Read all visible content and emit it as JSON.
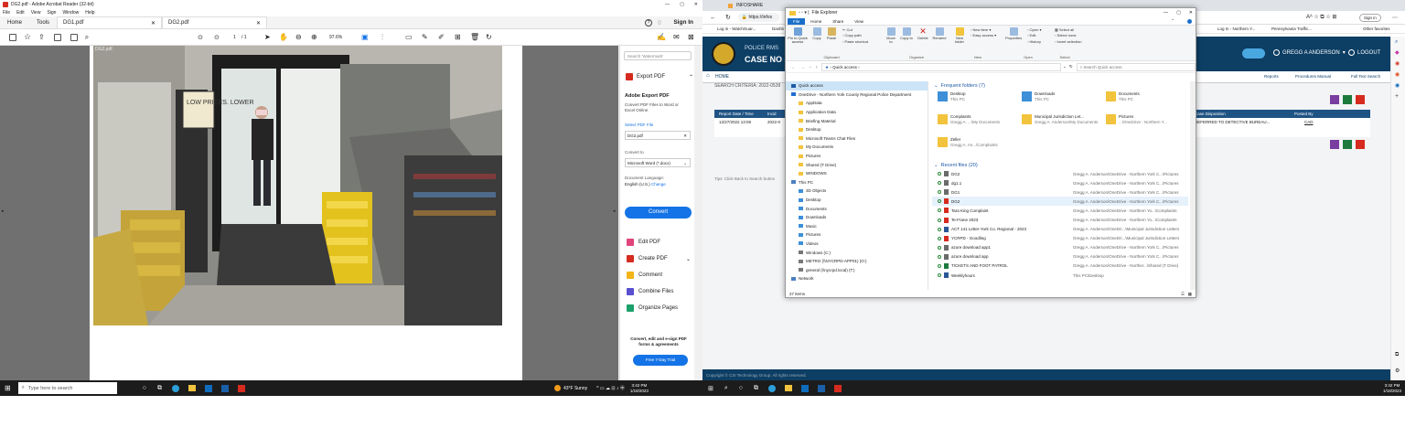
{
  "acrobat": {
    "window_title": "DG2.pdf - Adobe Acrobat Reader (32-bit)",
    "menu": [
      "File",
      "Edit",
      "View",
      "Sign",
      "Window",
      "Help"
    ],
    "tabs": {
      "home": "Home",
      "tools": "Tools",
      "doc1": "DG1.pdf",
      "doc2": "DG2.pdf"
    },
    "sign_in": "Sign In",
    "page_current": "1",
    "page_total": "/ 1",
    "zoom": "97.6%",
    "photo_caption": "DG2.pdf",
    "store_sign": "LOW PRICES. LOWER"
  },
  "export_panel": {
    "search_placeholder": "Search 'Watermark'",
    "title": "Export PDF",
    "heading": "Adobe Export PDF",
    "desc": "Convert PDF Files to Word or Excel Online",
    "select_label": "Select PDF File",
    "file": "DG2.pdf",
    "convert_to": "Convert to",
    "format": "Microsoft Word (*.docx)",
    "lang_label": "Document Language:",
    "lang": "English (U.S.)",
    "change": "Change",
    "convert_btn": "Convert",
    "tools": [
      "Edit PDF",
      "Create PDF",
      "Comment",
      "Combine Files",
      "Organize Pages"
    ],
    "promo": "Convert, edit and e-sign PDF forms & agreements",
    "trial_btn": "Free 7-Day Trial"
  },
  "taskbar_left": {
    "search": "Type here to search",
    "weather": "43°F Sunny",
    "time": "3:42 PM",
    "date": "1/18/2023"
  },
  "browser": {
    "tab": "INFOSHARE",
    "url": "https://infos",
    "bookmarks": [
      "Log in - WatchGuar...",
      "Dashb",
      "Log In - Northern Y...",
      "Pennsylvania Traffic...",
      "Other favorites"
    ],
    "sign_in": "Sign in"
  },
  "rms": {
    "line1": "POLICE RMS",
    "line2": "CASE NO SE",
    "user": "GREGG A ANDERSON",
    "logout": "LOGOUT",
    "home": "HOME",
    "criteria_label": "SEARCH CRITERIA:",
    "criteria_value": "2022-0539",
    "links": [
      "Reports",
      "Procedures Manual",
      "Full Text Search"
    ],
    "columns": [
      "Report Date / Time",
      "Incid",
      "Case Disposition",
      "Posted By"
    ],
    "row": {
      "date": "12/27/2022 13:08",
      "id": "2022-0",
      "disposition": "REFERRED TO DETECTIVE BUREAU...",
      "posted": "CAD"
    },
    "tips": "Tips: Click Back to Search button",
    "footer": "Copyright © CSI Technology Group. All rights reserved."
  },
  "file_explorer": {
    "title": "File Explorer",
    "ribbon_tabs": [
      "File",
      "Home",
      "Share",
      "View"
    ],
    "ribbon": {
      "pin": "Pin to Quick access",
      "copy": "Copy",
      "paste": "Paste",
      "cut": "Cut",
      "copy_path": "Copy path",
      "paste_shortcut": "Paste shortcut",
      "move_to": "Move to",
      "copy_to": "Copy to",
      "delete": "Delete",
      "rename": "Rename",
      "new_folder": "New folder",
      "new_item": "New item",
      "easy_access": "Easy access",
      "properties": "Properties",
      "open": "Open",
      "edit": "Edit",
      "history": "History",
      "select_all": "Select all",
      "select_none": "Select none",
      "invert": "Invert selection",
      "groups": [
        "Clipboard",
        "Organize",
        "New",
        "Open",
        "Select"
      ]
    },
    "address": "Quick access",
    "search_placeholder": "Search Quick access",
    "nav": [
      {
        "label": "Quick access",
        "kind": "star"
      },
      {
        "label": "OneDrive - Northern York County Regional Police Department",
        "kind": "cloud"
      },
      {
        "label": "AppData",
        "kind": "folder"
      },
      {
        "label": "Application Data",
        "kind": "folder"
      },
      {
        "label": "Briefing Material",
        "kind": "folder"
      },
      {
        "label": "Desktop",
        "kind": "folder"
      },
      {
        "label": "Microsoft Teams Chat Files",
        "kind": "folder"
      },
      {
        "label": "My Documents",
        "kind": "folder"
      },
      {
        "label": "Pictures",
        "kind": "folder"
      },
      {
        "label": "Shared (T Drive)",
        "kind": "folder"
      },
      {
        "label": "WINDOWS",
        "kind": "folder"
      },
      {
        "label": "This PC",
        "kind": "pc"
      },
      {
        "label": "3D Objects",
        "kind": "blue"
      },
      {
        "label": "Desktop",
        "kind": "blue"
      },
      {
        "label": "Documents",
        "kind": "blue"
      },
      {
        "label": "Downloads",
        "kind": "blue"
      },
      {
        "label": "Music",
        "kind": "blue"
      },
      {
        "label": "Pictures",
        "kind": "blue"
      },
      {
        "label": "Videos",
        "kind": "blue"
      },
      {
        "label": "Windows (C:)",
        "kind": "drive"
      },
      {
        "label": "METRO (\\\\NYCRPD-APP01) (O:)",
        "kind": "drive"
      },
      {
        "label": "general (\\\\nycrpd.local) (T:)",
        "kind": "drive"
      },
      {
        "label": "Network",
        "kind": "net"
      }
    ],
    "frequent_header": "Frequent folders (7)",
    "frequent": [
      {
        "name": "Desktop",
        "sub": "This PC"
      },
      {
        "name": "Downloads",
        "sub": "This PC"
      },
      {
        "name": "Documents",
        "sub": "This PC"
      },
      {
        "name": "Complaints",
        "sub": "Gregg A. ...\\My Documents"
      },
      {
        "name": "Municipal Jurisdiction Let...",
        "sub": "Gregg A. Anderson\\My Documents"
      },
      {
        "name": "Pictures",
        "sub": "...\\OneDrive - Northern Y..."
      },
      {
        "name": "Zeller",
        "sub": "Gregg A. An...\\Complaints"
      }
    ],
    "recent_header": "Recent files (20)",
    "recent": [
      {
        "name": "DG2",
        "path": "Gregg A. Anderson\\OneDrive - Northern York C...\\Pictures",
        "kind": "img"
      },
      {
        "name": "dg1.1",
        "path": "Gregg A. Anderson\\OneDrive - Northern York C...\\Pictures",
        "kind": "img"
      },
      {
        "name": "DG1",
        "path": "Gregg A. Anderson\\OneDrive - Northern York C...\\Pictures",
        "kind": "img"
      },
      {
        "name": "DG2",
        "path": "Gregg A. Anderson\\OneDrive - Northern York C...\\Pictures",
        "kind": "pdf"
      },
      {
        "name": "Tara King Complaint",
        "path": "Gregg A. Anderson\\OneDrive - Northern Yo...\\Complaints",
        "kind": "pdf"
      },
      {
        "name": "Te-Frane 2023",
        "path": "Gregg A. Anderson\\OneDrive - Northern Yo...\\Complaints",
        "kind": "pdf"
      },
      {
        "name": "ACT 141 Letter-York Co. Regional - 2023",
        "path": "Gregg A. Anderson\\OneDri...\\Municipal Jurisdiction Letters",
        "kind": "doc"
      },
      {
        "name": "YCRPD - Goodling",
        "path": "Gregg A. Anderson\\OneDri...\\Municipal Jurisdiction Letters",
        "kind": "pdf"
      },
      {
        "name": "azure download app1",
        "path": "Gregg A. Anderson\\OneDrive - Northern York C...\\Pictures",
        "kind": "img"
      },
      {
        "name": "azure download app",
        "path": "Gregg A. Anderson\\OneDrive - Northern York C...\\Pictures",
        "kind": "img"
      },
      {
        "name": "TICKETS AND FOOT PATROL",
        "path": "Gregg A. Anderson\\OneDrive - Norther...\\Shared (T Drive)",
        "kind": "xls"
      },
      {
        "name": "Weeklyhours",
        "path": "This PC\\Desktop",
        "kind": "doc"
      }
    ],
    "status": "27 items"
  },
  "taskbar_right": {
    "time": "3:42 PM",
    "date": "1/18/2023"
  },
  "colors": {
    "rms_navy": "#0d3e64",
    "acrobat_red": "#d62b1f",
    "convert_blue": "#1473e6",
    "explorer_blue": "#1e5aa8"
  }
}
